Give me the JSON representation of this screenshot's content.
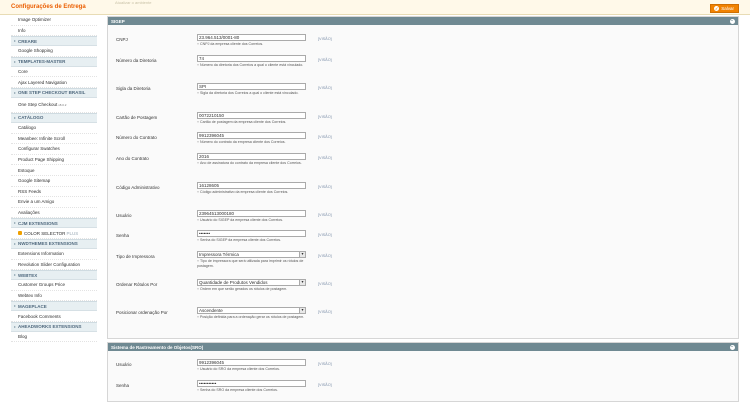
{
  "header": {
    "title": "Configurações de Entrega",
    "ghost_text": "Atualizar o ambiente",
    "save_label": "Salvar"
  },
  "sidebar": {
    "top_items": [
      "Image Optimizer",
      "Info"
    ],
    "sections": [
      {
        "title": "CREARE",
        "items": [
          "Google Shopping"
        ]
      },
      {
        "title": "TEMPLATES-MASTER",
        "items": [
          "Core",
          "Ajax Layered Navigation"
        ]
      },
      {
        "title": "ONE STEP CHECKOUT BRASIL",
        "items": [
          "One Step Checkout"
        ],
        "version": "v8.0.2"
      },
      {
        "title": "CATÁLOGO",
        "items": [
          "Catálogo",
          "Meanbee: Infinite Scroll",
          "Configurar Swatches",
          "Product Page Shipping",
          "Estoque",
          "Google Sitemap",
          "RSS Feeds",
          "Envie a um Amigo",
          "Avaliações"
        ]
      },
      {
        "title": "CJM EXTENSIONS",
        "items": [
          "COLOR SELECTOR"
        ],
        "plus": "PLUS"
      },
      {
        "title": "NWDTHEMES EXTENSIONS",
        "items": [
          "Extensions Information",
          "Revolution Slider Configuration"
        ]
      },
      {
        "title": "WEBTEX",
        "items": [
          "Customer Groups Price",
          "Webtex Info"
        ]
      },
      {
        "title": "MAGEPLACE",
        "items": [
          "Facebook Comments"
        ]
      },
      {
        "title": "AHEADWORKS EXTENSIONS",
        "items": [
          "Blog"
        ]
      }
    ]
  },
  "sigep": {
    "title": "SIGEP",
    "scope": "[VISÃO]",
    "fields": [
      {
        "label": "CNPJ",
        "value": "23.964.513/0001-80",
        "note": "CNPJ da empresa cliente dos Correios."
      },
      {
        "label": "Número da Diretoria",
        "value": "74",
        "note": "Número da diretoria dos Correios a qual o cliente está vinculado."
      },
      {
        "label": "Sigla da Diretoria",
        "value": "SPI",
        "note": "Sigla da diretoria dos Correios a qual o cliente está vinculado."
      },
      {
        "label": "Cartão de Postagem",
        "value": "0072210150",
        "note": "Cartão de postagem da empresa cliente dos Correios."
      },
      {
        "label": "Número do Contrato",
        "value": "9912396045",
        "note": "Número do contrato da empresa cliente dos Correios."
      },
      {
        "label": "Ano do Contrato",
        "value": "2016",
        "note": "Ano de assinatura do contrato da empresa cliente dos Correios."
      },
      {
        "label": "Código Administrativo",
        "value": "16128605",
        "note": "Código administrativo da empresa cliente dos Correios."
      },
      {
        "label": "Usuário",
        "value": "23964513000180",
        "note": "Usuário do SIGEP da empresa cliente dos Correios."
      },
      {
        "label": "Senha",
        "value": "•••••••",
        "note": "Senha do SIGEP da empresa cliente dos Correios."
      },
      {
        "label": "Tipo de Impressora",
        "value": "Impressora Térmica",
        "note": "Tipo de impressora que será utilizada para imprimir os rótulos de postagem."
      },
      {
        "label": "Ordenar Rótulos Por",
        "value": "Quantidade de Produtos Vendidos",
        "note": "Ordem em que serão gerados os rótulos de postagem."
      },
      {
        "label": "Posicionar ordenação Por",
        "value": "Ascendente",
        "note": "Posição definida para a ordenação gerar os rótulos de postagem."
      }
    ]
  },
  "sro": {
    "title": "Sistema de Rastreamento de Objetos(SRO)",
    "scope": "[VISÃO]",
    "fields": [
      {
        "label": "Usuário",
        "value": "9912396045",
        "note": "Usuário do SRO da empresa cliente dos Correios."
      },
      {
        "label": "Senha",
        "value": "•••••••••••",
        "note": "Senha do SRO da empresa cliente dos Correios."
      }
    ]
  }
}
